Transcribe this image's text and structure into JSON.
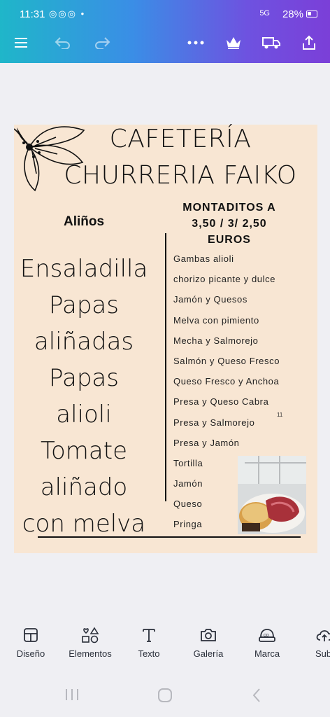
{
  "status": {
    "time": "11:31",
    "notif_icons": "◎◎◎ •",
    "signal": "5G",
    "battery": "28%"
  },
  "topbar": {
    "icons": [
      "menu-icon",
      "undo-icon",
      "redo-icon",
      "more-icon",
      "crown-icon",
      "truck-icon",
      "share-icon"
    ]
  },
  "design": {
    "title_line1": "CAFETERÍA",
    "title_line2": "CHURRERIA FAIKO",
    "alinos_header": "Aliños",
    "montaditos_header_1": "MONTADITOS A",
    "montaditos_header_2": "3,50 / 3/ 2,50",
    "montaditos_header_3": "EUROS",
    "alinos_lines": [
      "Ensaladilla",
      "Papas",
      "aliñadas",
      "Papas",
      "alioli",
      "Tomate",
      "aliñado",
      "con melva"
    ],
    "montaditos": [
      "Gambas alioli",
      "chorizo picante y dulce",
      "Jamón y Quesos",
      "Melva con pimiento",
      "Mecha y Salmorejo",
      "Salmón y Queso Fresco",
      "Queso Fresco y Anchoa",
      "Presa y Queso Cabra",
      "Presa y Salmorejo",
      "Presa y Jamón",
      "Tortilla",
      "Jamón",
      "Queso",
      "Pringa"
    ],
    "tick_mark": "11"
  },
  "bottom_toolbar": [
    {
      "label": "Diseño",
      "icon": "design-icon"
    },
    {
      "label": "Elementos",
      "icon": "elements-icon"
    },
    {
      "label": "Texto",
      "icon": "text-icon"
    },
    {
      "label": "Galería",
      "icon": "camera-icon"
    },
    {
      "label": "Marca",
      "icon": "brand-icon"
    },
    {
      "label": "Subi",
      "icon": "upload-icon"
    }
  ],
  "colors": {
    "canvas_bg": "#f8e6d3",
    "page_bg": "#efeff3",
    "gradient_start": "#1fb6c9",
    "gradient_end": "#7b3fd8"
  }
}
